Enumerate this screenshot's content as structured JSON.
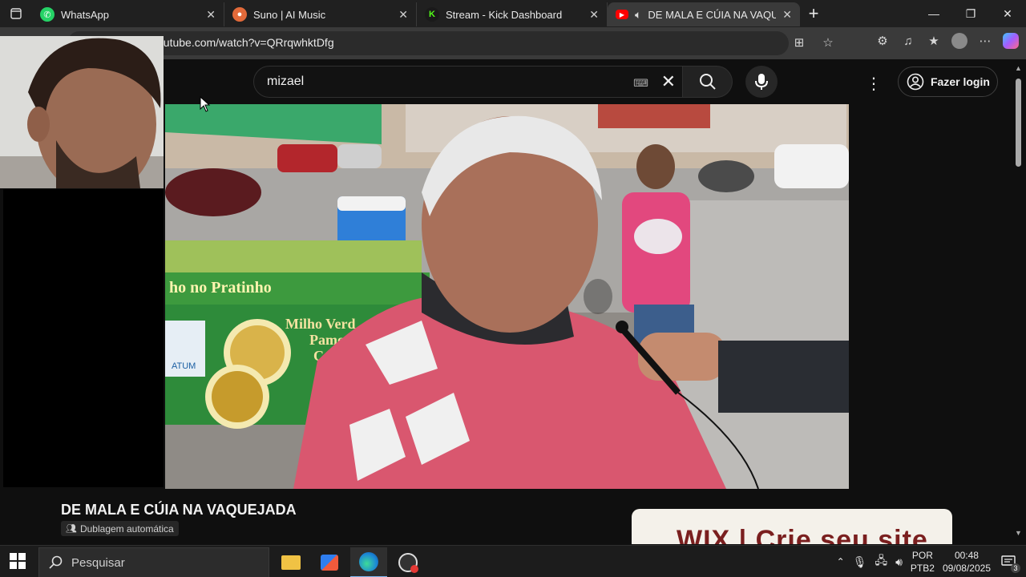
{
  "browser": {
    "tabs": [
      {
        "title": "WhatsApp",
        "favicon": "whatsapp-icon",
        "color": "#25D366"
      },
      {
        "title": "Suno | AI Music",
        "favicon": "suno-icon",
        "color": "#e26a3a"
      },
      {
        "title": "Stream - Kick Dashboard",
        "favicon": "kick-icon",
        "color": "#53fc18"
      },
      {
        "title": "DE MALA E CÚIA NA VAQUE",
        "favicon": "youtube-icon",
        "color": "#ff0000"
      }
    ],
    "url": "outube.com/watch?v=QRrqwhktDfg"
  },
  "youtube": {
    "search_query": "mizael",
    "login_label": "Fazer login",
    "video_title": "DE MALA E CÚIA NA VAQUEJADA",
    "dub_badge": "Dublagem automática",
    "ad_text": "WIX | Crie seu site"
  },
  "video_scene": {
    "sign_text": "ho no Pratinho",
    "menu_line1": "Milho Verd",
    "menu_line2": "Pamo",
    "menu_line3": "Car",
    "logo_text": "ATUM"
  },
  "taskbar": {
    "search_placeholder": "Pesquisar",
    "lang_line1": "POR",
    "lang_line2": "PTB2",
    "time": "00:48",
    "date": "09/08/2025",
    "notification_count": "3"
  }
}
